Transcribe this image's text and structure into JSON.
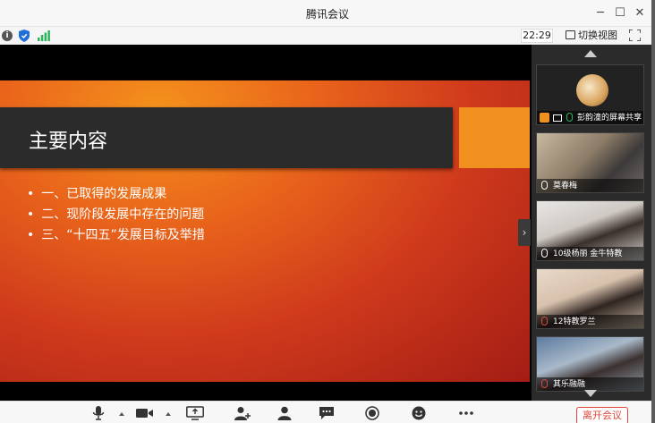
{
  "window": {
    "title": "腾讯会议"
  },
  "statusbar": {
    "time": "22:29",
    "switch_view_label": "切换视图"
  },
  "slide": {
    "title": "主要内容",
    "bullets": [
      "一、已取得的发展成果",
      "二、现阶段发展中存在的问题",
      "三、“十四五”发展目标及举措"
    ]
  },
  "participants": [
    {
      "name": "彭韵潼的屏幕共享"
    },
    {
      "name": "莫春梅"
    },
    {
      "name": "10级杨丽  金牛特教"
    },
    {
      "name": "12特教罗兰"
    },
    {
      "name": "其乐融融"
    }
  ],
  "controls": {
    "leave_label": "离开会议"
  },
  "colors": {
    "leave": "#e2463a",
    "signal": "#2db55d",
    "shield": "#1e6fd9"
  }
}
